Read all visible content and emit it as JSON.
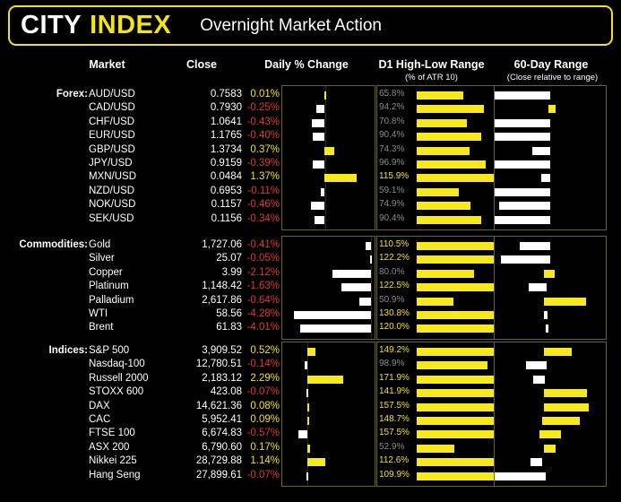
{
  "header": {
    "logo_primary": "CITY",
    "logo_accent": "INDEX",
    "title": "Overnight Market Action",
    "accent_color": "#f2e31a",
    "background_color": "#000000"
  },
  "columns": {
    "market": "Market",
    "close": "Close",
    "daily_change": "Daily % Change",
    "d1_range": "D1 High-Low Range",
    "d1_range_sub": "(% of ATR 10)",
    "sixty_day_range": "60-Day Range",
    "sixty_day_range_sub": "(Close relative to range)"
  },
  "groups": [
    {
      "label": "Forex:"
    },
    {
      "label": "Commodities:"
    },
    {
      "label": "Indices:"
    }
  ],
  "chart_data": {
    "type": "table",
    "title": "Overnight Market Action",
    "columns": [
      "Market",
      "Close",
      "Daily % Change",
      "D1 High-Low Range (% of ATR 10)",
      "60-Day Range (Close relative to range)"
    ],
    "groups": [
      {
        "name": "Forex",
        "rows": [
          {
            "market": "AUD/USD",
            "close": "0.7583",
            "pct": "0.01%",
            "pct_value": 0.01,
            "atr": "65.8%",
            "atr_value": 65.8,
            "range_pos": 0.0
          },
          {
            "market": "CAD/USD",
            "close": "0.7930",
            "pct": "-0.25%",
            "pct_value": -0.25,
            "atr": "94.2%",
            "atr_value": 94.2,
            "range_pos": 0.93
          },
          {
            "market": "CHF/USD",
            "close": "1.0641",
            "pct": "-0.43%",
            "pct_value": -0.43,
            "atr": "70.8%",
            "atr_value": 70.8,
            "range_pos": 0.0
          },
          {
            "market": "EUR/USD",
            "close": "1.1765",
            "pct": "-0.40%",
            "pct_value": -0.4,
            "atr": "90.4%",
            "atr_value": 90.4,
            "range_pos": 0.0
          },
          {
            "market": "GBP/USD",
            "close": "1.3734",
            "pct": "0.37%",
            "pct_value": 0.37,
            "atr": "74.3%",
            "atr_value": 74.3,
            "range_pos": 0.66
          },
          {
            "market": "JPY/USD",
            "close": "0.9159",
            "pct": "-0.39%",
            "pct_value": -0.39,
            "atr": "96.9%",
            "atr_value": 96.9,
            "range_pos": 0.0
          },
          {
            "market": "MXN/USD",
            "close": "0.0484",
            "pct": "1.37%",
            "pct_value": 1.37,
            "atr": "115.9%",
            "atr_value": 115.9,
            "range_pos": 0.8
          },
          {
            "market": "NZD/USD",
            "close": "0.6953",
            "pct": "-0.11%",
            "pct_value": -0.11,
            "atr": "59.1%",
            "atr_value": 59.1,
            "range_pos": 0.0
          },
          {
            "market": "NOK/USD",
            "close": "0.1157",
            "pct": "-0.46%",
            "pct_value": -0.46,
            "atr": "74.9%",
            "atr_value": 74.9,
            "range_pos": 0.08
          },
          {
            "market": "SEK/USD",
            "close": "0.1156",
            "pct": "-0.34%",
            "pct_value": -0.34,
            "atr": "90.4%",
            "atr_value": 90.4,
            "range_pos": 0.0
          }
        ]
      },
      {
        "name": "Commodities",
        "rows": [
          {
            "market": "Gold",
            "close": "1,727.06",
            "pct": "-0.41%",
            "pct_value": -0.41,
            "atr": "110.5%",
            "atr_value": 110.5,
            "range_pos": 0.26
          },
          {
            "market": "Silver",
            "close": "25.07",
            "pct": "-0.05%",
            "pct_value": -0.05,
            "atr": "122.2%",
            "atr_value": 122.2,
            "range_pos": 0.07
          },
          {
            "market": "Copper",
            "close": "3.99",
            "pct": "-2.12%",
            "pct_value": -2.12,
            "atr": "80.0%",
            "atr_value": 80.0,
            "range_pos": 0.57
          },
          {
            "market": "Platinum",
            "close": "1,148.42",
            "pct": "-1.63%",
            "pct_value": -1.63,
            "atr": "122.5%",
            "atr_value": 122.5,
            "range_pos": 0.38
          },
          {
            "market": "Palladium",
            "close": "2,617.86",
            "pct": "-0.64%",
            "pct_value": -0.64,
            "atr": "50.9%",
            "atr_value": 50.9,
            "range_pos": 0.56
          },
          {
            "market": "WTI",
            "close": "58.56",
            "pct": "-4.28%",
            "pct_value": -4.28,
            "atr": "130.8%",
            "atr_value": 130.8,
            "range_pos": 0.55
          },
          {
            "market": "Brent",
            "close": "61.83",
            "pct": "-4.01%",
            "pct_value": -4.01,
            "atr": "120.0%",
            "atr_value": 120.0,
            "range_pos": 0.56
          }
        ]
      },
      {
        "name": "Indices",
        "rows": [
          {
            "market": "S&P 500",
            "close": "3,909.52",
            "pct": "0.52%",
            "pct_value": 0.52,
            "atr": "149.2%",
            "atr_value": 149.2,
            "range_pos": 0.57
          },
          {
            "market": "Nasdaq-100",
            "close": "12,780.51",
            "pct": "-0.14%",
            "pct_value": -0.14,
            "atr": "98.9%",
            "atr_value": 98.9,
            "range_pos": 0.35
          },
          {
            "market": "Russell 2000",
            "close": "2,183.12",
            "pct": "2.29%",
            "pct_value": 2.29,
            "atr": "171.9%",
            "atr_value": 171.9,
            "range_pos": 0.43
          },
          {
            "market": "STOXX 600",
            "close": "423.08",
            "pct": "-0.07%",
            "pct_value": -0.07,
            "atr": "141.9%",
            "atr_value": 141.9,
            "range_pos": 0.57
          },
          {
            "market": "DAX",
            "close": "14,621.36",
            "pct": "0.08%",
            "pct_value": 0.08,
            "atr": "157.5%",
            "atr_value": 157.5,
            "range_pos": 0.57
          },
          {
            "market": "CAC",
            "close": "5,952.41",
            "pct": "0.09%",
            "pct_value": 0.09,
            "atr": "148.7%",
            "atr_value": 148.7,
            "range_pos": 0.55
          },
          {
            "market": "FTSE 100",
            "close": "6,674.83",
            "pct": "-0.57%",
            "pct_value": -0.57,
            "atr": "157.5%",
            "atr_value": 157.5,
            "range_pos": 0.5
          },
          {
            "market": "ASX 200",
            "close": "6,790.60",
            "pct": "0.17%",
            "pct_value": 0.17,
            "atr": "52.9%",
            "atr_value": 52.9,
            "range_pos": 0.56
          },
          {
            "market": "Nikkei 225",
            "close": "28,729.88",
            "pct": "1.14%",
            "pct_value": 1.14,
            "atr": "112.6%",
            "atr_value": 112.6,
            "range_pos": 0.44
          },
          {
            "market": "Hang Seng",
            "close": "27,899.61",
            "pct": "-0.07%",
            "pct_value": -0.07,
            "atr": "109.9%",
            "atr_value": 109.9,
            "range_pos": 0.0
          }
        ]
      }
    ],
    "colors": {
      "positive": "#f2e31a",
      "negative": "#e03a2f",
      "bar_hot": "#f7e91c",
      "bar_cool": "#ffffff",
      "panel_border": "#6b651a",
      "muted_label": "#8a8a8a"
    },
    "notes": {
      "atr_threshold": 100,
      "daily_pct_zero_center": true
    }
  }
}
